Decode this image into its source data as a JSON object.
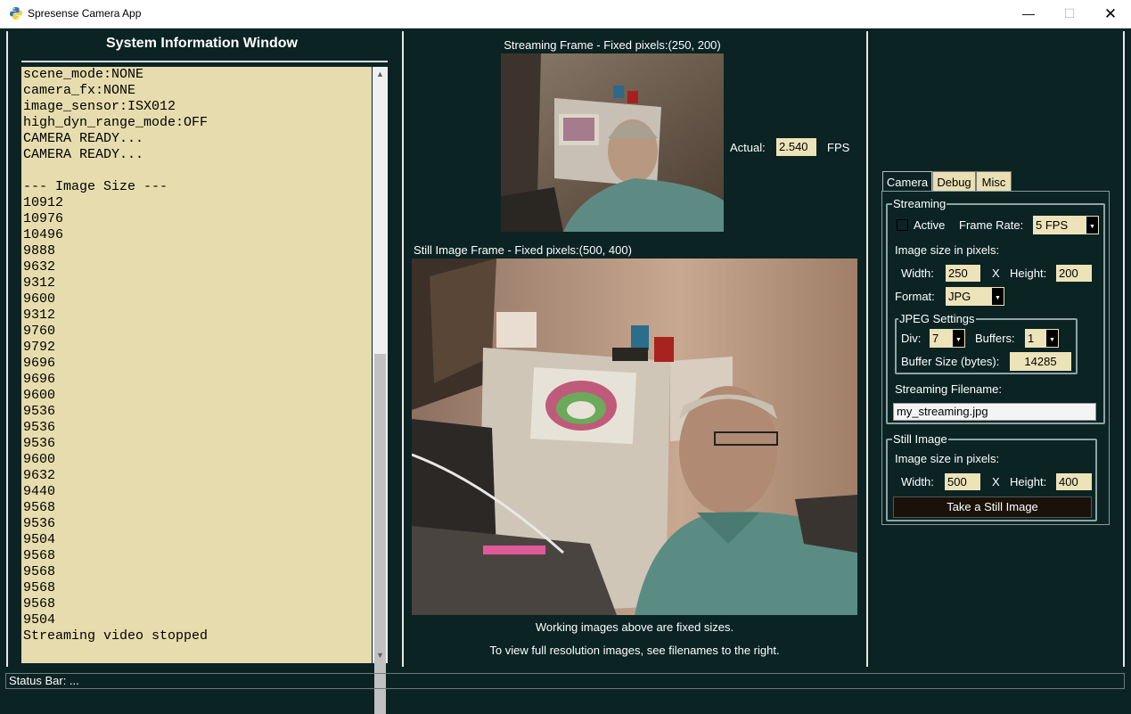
{
  "window": {
    "title": "Spresense Camera App",
    "minimize": "—",
    "maximize": "☐",
    "close": "✕"
  },
  "left_panel": {
    "title": "System Information Window",
    "log_lines": [
      "scene_mode:NONE",
      "camera_fx:NONE",
      "image_sensor:ISX012",
      "high_dyn_range_mode:OFF",
      "CAMERA READY...",
      "CAMERA READY...",
      "",
      "--- Image Size ---",
      "10912",
      "10976",
      "10496",
      "9888",
      "9632",
      "9312",
      "9600",
      "9312",
      "9760",
      "9792",
      "9696",
      "9696",
      "9600",
      "9536",
      "9536",
      "9536",
      "9600",
      "9632",
      "9440",
      "9568",
      "9536",
      "9504",
      "9568",
      "9568",
      "9568",
      "9568",
      "9504",
      "Streaming video stopped"
    ],
    "scroll_up": "▲",
    "scroll_down": "▼"
  },
  "center_panel": {
    "streaming_label": "Streaming Frame - Fixed pixels:(250, 200)",
    "still_label": "Still Image Frame - Fixed pixels:(500, 400)",
    "fps": {
      "label": "Actual:",
      "value": "2.540",
      "unit": "FPS"
    },
    "caption1": "Working images above are fixed sizes.",
    "caption2": "To view full resolution images, see filenames to the right."
  },
  "right_panel": {
    "tabs": [
      {
        "label": "Camera",
        "active": true
      },
      {
        "label": "Debug",
        "active": false
      },
      {
        "label": "Misc",
        "active": false
      }
    ],
    "streaming": {
      "legend": "Streaming",
      "active_label": "Active",
      "active_checked": false,
      "frame_rate_label": "Frame Rate:",
      "frame_rate_value": "5 FPS",
      "size_label": "Image size in pixels:",
      "width_label": "Width:",
      "width_value": "250",
      "x_label": "X",
      "height_label": "Height:",
      "height_value": "200",
      "format_label": "Format:",
      "format_value": "JPG",
      "jpeg": {
        "legend": "JPEG Settings",
        "div_label": "Div:",
        "div_value": "7",
        "buffers_label": "Buffers:",
        "buffers_value": "1",
        "buffer_size_label": "Buffer Size (bytes):",
        "buffer_size_value": "14285"
      },
      "filename_label": "Streaming Filename:",
      "filename_value": "my_streaming.jpg"
    },
    "still": {
      "legend": "Still Image",
      "size_label": "Image size in pixels:",
      "width_label": "Width:",
      "width_value": "500",
      "x_label": "X",
      "height_label": "Height:",
      "height_value": "400",
      "take_button": "Take a Still Image"
    }
  },
  "status_bar": {
    "text": "Status Bar: ..."
  },
  "colors": {
    "background": "#0b2323",
    "field": "#ede3b9",
    "log_bg": "#e6dcae"
  }
}
